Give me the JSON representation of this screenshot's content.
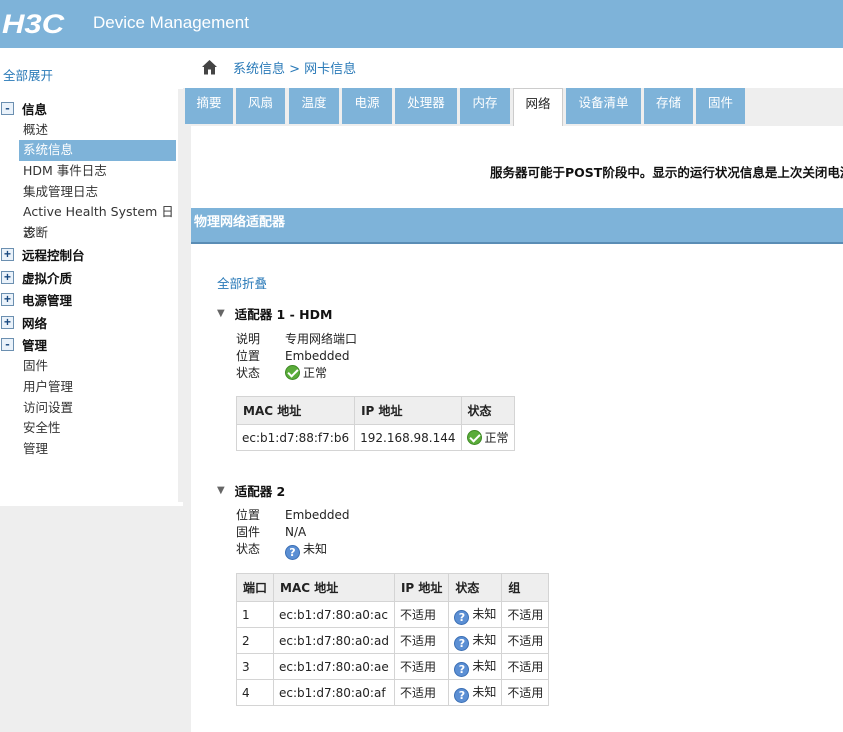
{
  "header": {
    "logo": "H3C",
    "title": "Device Management"
  },
  "sidebar": {
    "expand_all": "全部展开",
    "groups": [
      {
        "toggle": "-",
        "label": "信息",
        "items": [
          "概述",
          "系统信息",
          "HDM 事件日志",
          "集成管理日志",
          "Active Health System 日志",
          "诊断"
        ]
      },
      {
        "toggle": "+",
        "label": "远程控制台"
      },
      {
        "toggle": "+",
        "label": "虚拟介质"
      },
      {
        "toggle": "+",
        "label": "电源管理"
      },
      {
        "toggle": "+",
        "label": "网络"
      },
      {
        "toggle": "-",
        "label": "管理",
        "items": [
          "固件",
          "用户管理",
          "访问设置",
          "安全性",
          "管理"
        ]
      }
    ]
  },
  "breadcrumb": "系统信息 > 网卡信息",
  "tabs": [
    "摘要",
    "风扇",
    "温度",
    "电源",
    "处理器",
    "内存",
    "网络",
    "设备清单",
    "存储",
    "固件"
  ],
  "active_tab": "网络",
  "notice": "服务器可能于POST阶段中。显示的运行状况信息是上次关闭电源时",
  "section_title": "物理网络适配器",
  "collapse_all": "全部折叠",
  "adapter1": {
    "title": "适配器 1 - HDM",
    "rows": [
      {
        "key": "说明",
        "value": "专用网络端口"
      },
      {
        "key": "位置",
        "value": "Embedded"
      },
      {
        "key": "状态",
        "value": "正常",
        "icon": "ok-icon"
      }
    ],
    "table": {
      "headers": [
        "MAC 地址",
        "IP 地址",
        "状态"
      ],
      "rows": [
        [
          "ec:b1:d7:88:f7:b6",
          "192.168.98.144",
          "正常"
        ]
      ]
    }
  },
  "adapter2": {
    "title": "适配器 2",
    "rows": [
      {
        "key": "位置",
        "value": "Embedded"
      },
      {
        "key": "固件",
        "value": "N/A"
      },
      {
        "key": "状态",
        "value": "未知",
        "icon": "unknown-icon"
      }
    ],
    "table": {
      "headers": [
        "端口",
        "MAC 地址",
        "IP 地址",
        "状态",
        "组"
      ],
      "rows": [
        [
          "1",
          "ec:b1:d7:80:a0:ac",
          "不适用",
          "未知",
          "不适用"
        ],
        [
          "2",
          "ec:b1:d7:80:a0:ad",
          "不适用",
          "未知",
          "不适用"
        ],
        [
          "3",
          "ec:b1:d7:80:a0:ae",
          "不适用",
          "未知",
          "不适用"
        ],
        [
          "4",
          "ec:b1:d7:80:a0:af",
          "不适用",
          "未知",
          "不适用"
        ]
      ]
    }
  },
  "colors": {
    "accent": "#7eb3d9",
    "link": "#2a7ab8",
    "panel": "#eeeeee"
  }
}
